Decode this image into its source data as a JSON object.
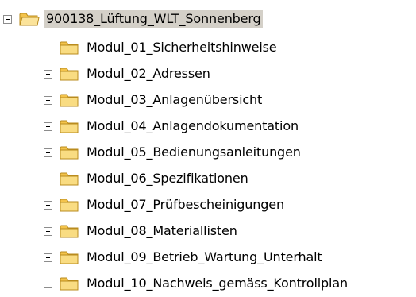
{
  "tree": {
    "root": {
      "label": "900138_Lüftung_WLT_Sonnenberg",
      "expanded": true,
      "selected": true
    },
    "children": [
      {
        "label": "Modul_01_Sicherheitshinweise",
        "expanded": false
      },
      {
        "label": "Modul_02_Adressen",
        "expanded": false
      },
      {
        "label": "Modul_03_Anlagenübersicht",
        "expanded": false
      },
      {
        "label": "Modul_04_Anlagendokumentation",
        "expanded": false
      },
      {
        "label": "Modul_05_Bedienungsanleitungen",
        "expanded": false
      },
      {
        "label": "Modul_06_Spezifikationen",
        "expanded": false
      },
      {
        "label": "Modul_07_Prüfbescheinigungen",
        "expanded": false
      },
      {
        "label": "Modul_08_Materiallisten",
        "expanded": false
      },
      {
        "label": "Modul_09_Betrieb_Wartung_Unterhalt",
        "expanded": false
      },
      {
        "label": "Modul_10_Nachweis_gemäss_Kontrollplan",
        "expanded": false
      }
    ]
  },
  "icons": {
    "folder": "folder-icon",
    "expand": "plus-toggle-icon",
    "collapse": "minus-toggle-icon"
  },
  "colors": {
    "selection_background": "#d4d0c8",
    "folder_fill": "#f7d673",
    "folder_outline": "#c59b2a"
  }
}
